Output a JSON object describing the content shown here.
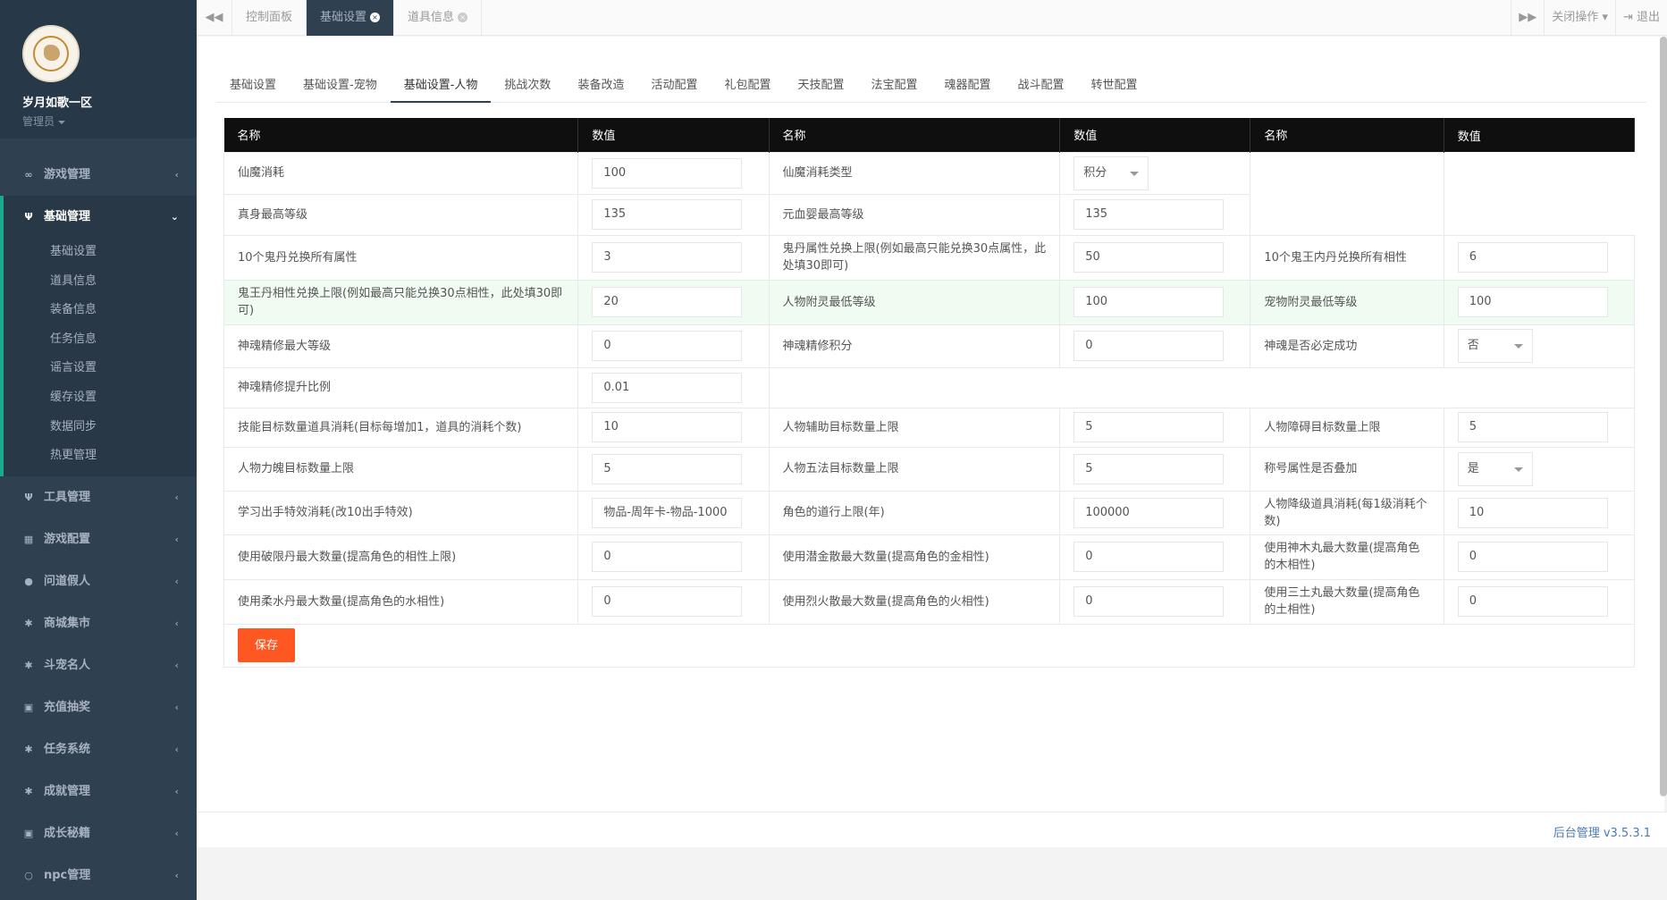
{
  "profile": {
    "name": "岁月如歌一区",
    "role": "管理员"
  },
  "nav": {
    "items_top": [
      {
        "icon": "∞",
        "label": "游戏管理"
      }
    ],
    "active_group": {
      "icon": "Ψ",
      "label": "基础管理",
      "children": [
        "基础设置",
        "道具信息",
        "装备信息",
        "任务信息",
        "谣言设置",
        "缓存设置",
        "数据同步",
        "热更管理"
      ]
    },
    "items_bottom": [
      {
        "icon": "Ψ",
        "label": "工具管理"
      },
      {
        "icon": "▦",
        "label": "游戏配置"
      },
      {
        "icon": "●",
        "label": "问道假人"
      },
      {
        "icon": "✱",
        "label": "商城集市"
      },
      {
        "icon": "✱",
        "label": "斗宠名人"
      },
      {
        "icon": "▣",
        "label": "充值抽奖"
      },
      {
        "icon": "✱",
        "label": "任务系统"
      },
      {
        "icon": "✱",
        "label": "成就管理"
      },
      {
        "icon": "▣",
        "label": "成长秘籍"
      },
      {
        "icon": "○",
        "label": "npc管理"
      }
    ]
  },
  "topbar": {
    "tabs": [
      {
        "label": "控制面板",
        "active": false,
        "closable": false
      },
      {
        "label": "基础设置",
        "active": true,
        "closable": true
      },
      {
        "label": "道具信息",
        "active": false,
        "closable": true
      }
    ],
    "close_ops": "关闭操作",
    "logout": "退出"
  },
  "subtabs": {
    "items": [
      "基础设置",
      "基础设置-宠物",
      "基础设置-人物",
      "挑战次数",
      "装备改造",
      "活动配置",
      "礼包配置",
      "天技配置",
      "法宝配置",
      "魂器配置",
      "战斗配置",
      "转世配置"
    ],
    "active_index": 2
  },
  "table": {
    "headers": [
      "名称",
      "数值",
      "名称",
      "数值",
      "名称",
      "数值"
    ],
    "rows": [
      {
        "height": 47,
        "cells": [
          {
            "label": "仙魔消耗",
            "type": "input",
            "value": "100"
          },
          {
            "label": "仙魔消耗类型",
            "type": "select",
            "value": "积分"
          },
          {
            "label": "",
            "type": "blank",
            "rowspan": 2
          }
        ]
      },
      {
        "height": 46,
        "cells": [
          {
            "label": "真身最高等级",
            "type": "input",
            "value": "135"
          },
          {
            "label": "元血婴最高等级",
            "type": "input",
            "value": "135"
          }
        ]
      },
      {
        "height": 50,
        "cells": [
          {
            "label": "10个鬼丹兑换所有属性",
            "type": "input",
            "value": "3"
          },
          {
            "label": "鬼丹属性兑换上限(例如最高只能兑换30点属性，此处填30即可)",
            "type": "input",
            "value": "50"
          },
          {
            "label": "10个鬼王内丹兑换所有相性",
            "type": "input",
            "value": "6"
          }
        ]
      },
      {
        "height": 50,
        "highlight": true,
        "cells": [
          {
            "label": "鬼王丹相性兑换上限(例如最高只能兑换30点相性，此处填30即可)",
            "type": "input",
            "value": "20"
          },
          {
            "label": "人物附灵最低等级",
            "type": "input",
            "value": "100"
          },
          {
            "label": "宠物附灵最低等级",
            "type": "input",
            "value": "100"
          }
        ]
      },
      {
        "height": 48,
        "cells": [
          {
            "label": "神魂精修最大等级",
            "type": "input",
            "value": "0"
          },
          {
            "label": "神魂精修积分",
            "type": "input",
            "value": "0"
          },
          {
            "label": "神魂是否必定成功",
            "type": "select",
            "value": "否"
          }
        ]
      },
      {
        "height": 45,
        "cells": [
          {
            "label": "神魂精修提升比例",
            "type": "input",
            "value": "0.01"
          },
          {
            "label": "",
            "type": "blank",
            "colspan": 4
          }
        ]
      },
      {
        "height": 44,
        "cells": [
          {
            "label": "技能目标数量道具消耗(目标每增加1，道具的消耗个数)",
            "type": "input",
            "value": "10"
          },
          {
            "label": "人物辅助目标数量上限",
            "type": "input",
            "value": "5"
          },
          {
            "label": "人物障碍目标数量上限",
            "type": "input",
            "value": "5"
          }
        ]
      },
      {
        "height": 49,
        "cells": [
          {
            "label": "人物力魄目标数量上限",
            "type": "input",
            "value": "5"
          },
          {
            "label": "人物五法目标数量上限",
            "type": "input",
            "value": "5"
          },
          {
            "label": "称号属性是否叠加",
            "type": "select",
            "value": "是"
          }
        ]
      },
      {
        "height": 49,
        "cells": [
          {
            "label": "学习出手特效消耗(改10出手特效)",
            "type": "input",
            "value": "物品-周年卡-物品-1000"
          },
          {
            "label": "角色的道行上限(年)",
            "type": "input",
            "value": "100000"
          },
          {
            "label": "人物降级道具消耗(每1级消耗个数)",
            "type": "input",
            "value": "10"
          }
        ]
      },
      {
        "height": 50,
        "cells": [
          {
            "label": "使用破限丹最大数量(提高角色的相性上限)",
            "type": "input",
            "value": "0"
          },
          {
            "label": "使用潜金散最大数量(提高角色的金相性)",
            "type": "input",
            "value": "0"
          },
          {
            "label": "使用神木丸最大数量(提高角色的木相性)",
            "type": "input",
            "value": "0"
          }
        ]
      },
      {
        "height": 50,
        "cells": [
          {
            "label": "使用柔水丹最大数量(提高角色的水相性)",
            "type": "input",
            "value": "0"
          },
          {
            "label": "使用烈火散最大数量(提高角色的火相性)",
            "type": "input",
            "value": "0"
          },
          {
            "label": "使用三土丸最大数量(提高角色的土相性)",
            "type": "input",
            "value": "0"
          }
        ]
      }
    ],
    "save_label": "保存"
  },
  "footer": {
    "version": "后台管理 v3.5.3.1"
  }
}
